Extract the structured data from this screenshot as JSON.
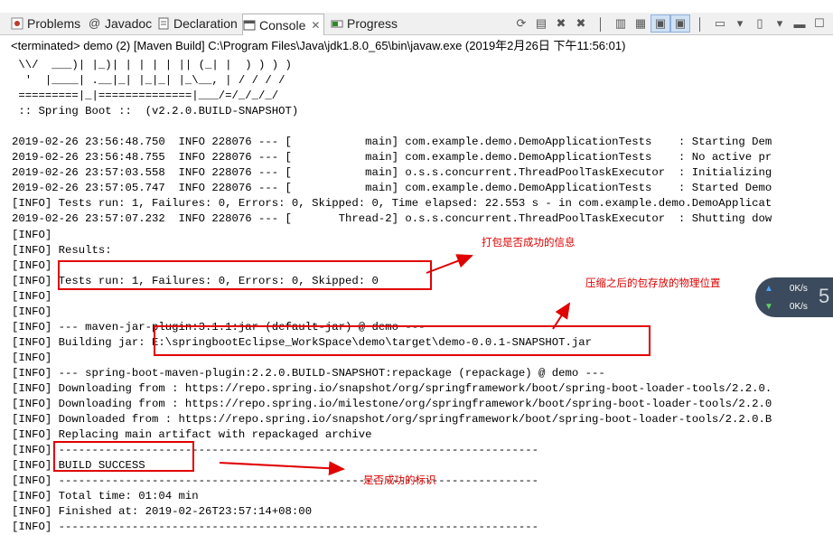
{
  "tabs": [
    {
      "label": "Problems",
      "icon": "problems-icon",
      "color": "#c0392b"
    },
    {
      "label": "Javadoc",
      "icon": "at-sign-icon",
      "color": "#555"
    },
    {
      "label": "Declaration",
      "icon": "declaration-icon",
      "color": "#556"
    },
    {
      "label": "Console",
      "icon": "console-icon",
      "color": "#333",
      "active": true,
      "close": "✕"
    },
    {
      "label": "Progress",
      "icon": "progress-icon",
      "color": "#2a8a2a"
    }
  ],
  "status_line": "<terminated> demo (2) [Maven Build] C:\\Program Files\\Java\\jdk1.8.0_65\\bin\\javaw.exe (2019年2月26日 下午11:56:01)",
  "console_lines": [
    " \\\\/  ___)| |_)| | | | | || (_| |  ) ) ) )",
    "  '  |____| .__|_| |_|_| |_\\__, | / / / /",
    " =========|_|==============|___/=/_/_/_/",
    " :: Spring Boot ::  (v2.2.0.BUILD-SNAPSHOT)",
    "",
    "2019-02-26 23:56:48.750  INFO 228076 --- [           main] com.example.demo.DemoApplicationTests    : Starting Dem",
    "2019-02-26 23:56:48.755  INFO 228076 --- [           main] com.example.demo.DemoApplicationTests    : No active pr",
    "2019-02-26 23:57:03.558  INFO 228076 --- [           main] o.s.s.concurrent.ThreadPoolTaskExecutor  : Initializing",
    "2019-02-26 23:57:05.747  INFO 228076 --- [           main] com.example.demo.DemoApplicationTests    : Started Demo",
    "[INFO] Tests run: 1, Failures: 0, Errors: 0, Skipped: 0, Time elapsed: 22.553 s - in com.example.demo.DemoApplicat",
    "2019-02-26 23:57:07.232  INFO 228076 --- [       Thread-2] o.s.s.concurrent.ThreadPoolTaskExecutor  : Shutting dow",
    "[INFO]",
    "[INFO] Results:",
    "[INFO]",
    "[INFO] Tests run: 1, Failures: 0, Errors: 0, Skipped: 0",
    "[INFO]",
    "[INFO]",
    "[INFO] --- maven-jar-plugin:3.1.1:jar (default-jar) @ demo ---",
    "[INFO] Building jar: E:\\springbootEclipse_WorkSpace\\demo\\target\\demo-0.0.1-SNAPSHOT.jar",
    "[INFO]",
    "[INFO] --- spring-boot-maven-plugin:2.2.0.BUILD-SNAPSHOT:repackage (repackage) @ demo ---",
    "[INFO] Downloading from : https://repo.spring.io/snapshot/org/springframework/boot/spring-boot-loader-tools/2.2.0.",
    "[INFO] Downloading from : https://repo.spring.io/milestone/org/springframework/boot/spring-boot-loader-tools/2.2.0",
    "[INFO] Downloaded from : https://repo.spring.io/snapshot/org/springframework/boot/spring-boot-loader-tools/2.2.0.B",
    "[INFO] Replacing main artifact with repackaged archive",
    "[INFO] ------------------------------------------------------------------------",
    "[INFO] BUILD SUCCESS",
    "[INFO] ------------------------------------------------------------------------",
    "[INFO] Total time: 01:04 min",
    "[INFO] Finished at: 2019-02-26T23:57:14+08:00",
    "[INFO] ------------------------------------------------------------------------"
  ],
  "annotations": {
    "note1": "打包是否成功的信息",
    "note2": "压缩之后的包存放的物理位置",
    "note3": "是否成功的标识",
    "color": "#e00000"
  },
  "net_widget": {
    "up": "0K/s",
    "down": "0K/s",
    "digit": "5"
  }
}
